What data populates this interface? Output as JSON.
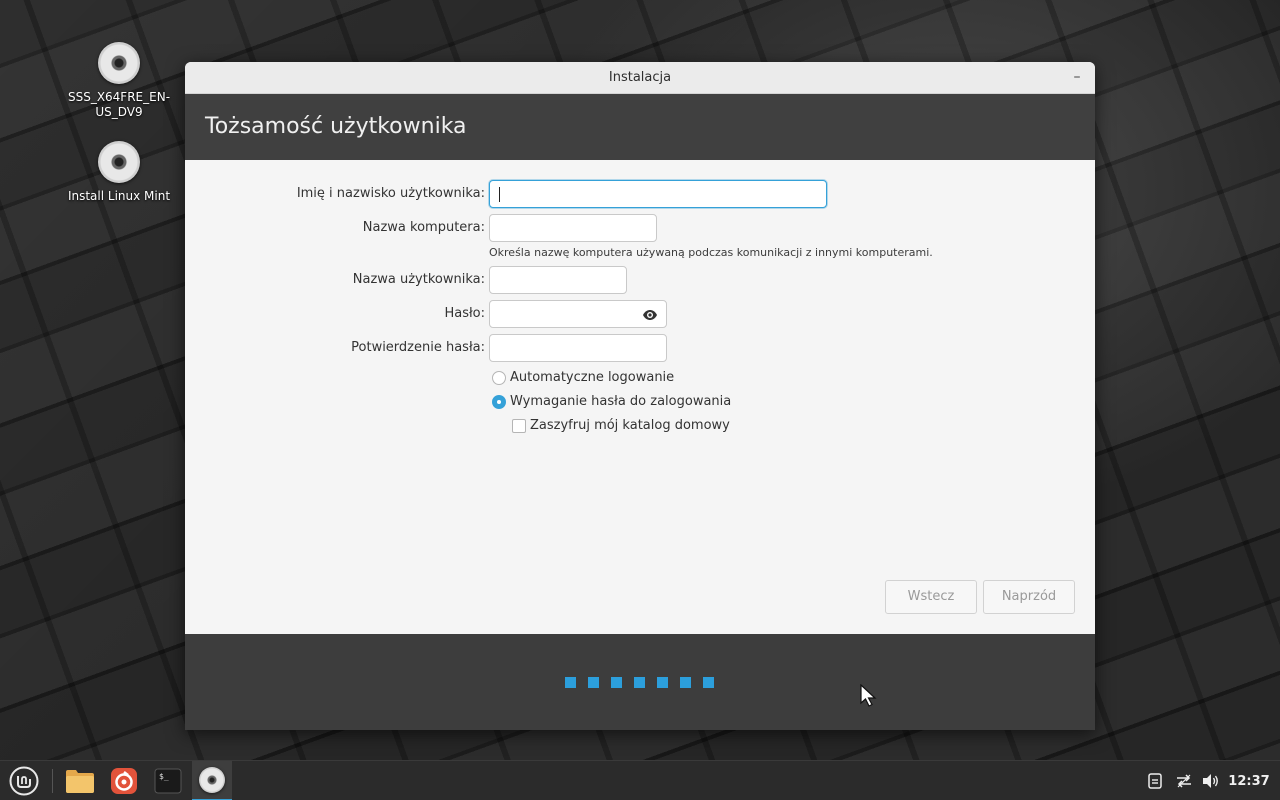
{
  "desktop": {
    "icons": [
      {
        "label": "SSS_X64FRE_EN-US_DV9"
      },
      {
        "label": "Install Linux Mint"
      }
    ]
  },
  "window": {
    "title": "Instalacja",
    "minimize_glyph": "–",
    "header_title": "Tożsamość użytkownika"
  },
  "form": {
    "full_name_label": "Imię i nazwisko użytkownika:",
    "full_name_value": "",
    "computer_name_label": "Nazwa komputera:",
    "computer_name_value": "",
    "computer_name_hint": "Określa nazwę komputera używaną podczas komunikacji z innymi komputerami.",
    "username_label": "Nazwa użytkownika:",
    "username_value": "",
    "password_label": "Hasło:",
    "password_value": "",
    "password_confirm_label": "Potwierdzenie hasła:",
    "password_confirm_value": "",
    "auto_login_label": "Automatyczne logowanie",
    "auto_login_selected": false,
    "require_password_label": "Wymaganie hasła do zalogowania",
    "require_password_selected": true,
    "encrypt_home_label": "Zaszyfruj mój katalog domowy",
    "encrypt_home_checked": false
  },
  "buttons": {
    "back": "Wstecz",
    "next": "Naprzód"
  },
  "progress": {
    "steps_total": 7
  },
  "taskbar": {
    "apps": [
      "menu-icon",
      "files-icon",
      "browser-icon",
      "terminal-icon",
      "installer-icon"
    ],
    "clock": "12:37"
  },
  "colors": {
    "accent": "#35a1d8",
    "header_bg": "#404040",
    "footer_bg": "#3d3d3d",
    "taskbar_bg": "#2b2b2b"
  }
}
